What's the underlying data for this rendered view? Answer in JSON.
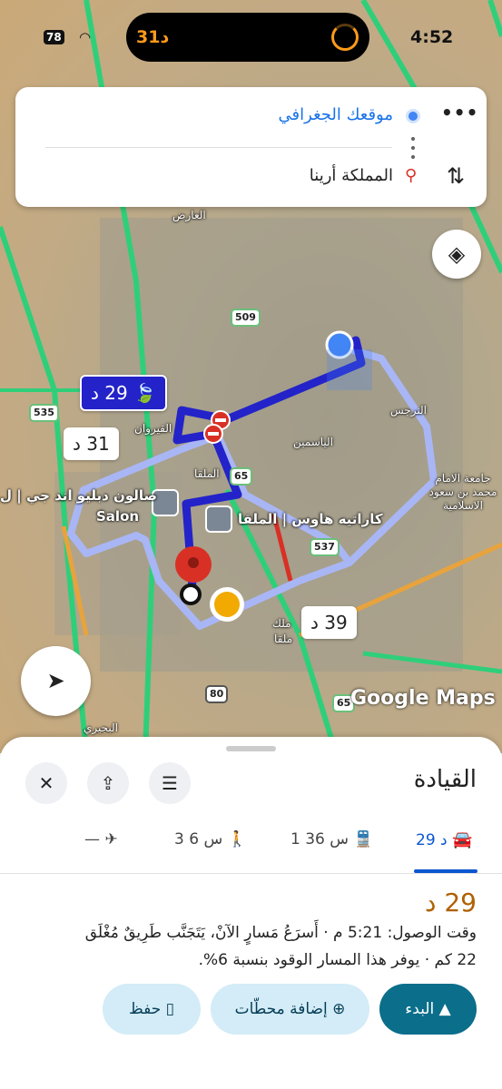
{
  "status_bar": {
    "time": "4:52",
    "battery": "78",
    "island_text": "31د"
  },
  "route_inputs": {
    "origin": "موقعك الجغرافي",
    "destination": "المملكة أرينا"
  },
  "map": {
    "labels": {
      "alaridh": "العارض",
      "alqirawan": "القيروان",
      "alyasmin": "الياسمين",
      "alnarjis": "النرجس",
      "almalqa": "الملقا",
      "salon_ar": "صالون دبليو اند جي | ل",
      "salon_en": "Salon",
      "karatih": "كاراتيه هاوس | الملقا",
      "university": "جامعة الامام محمد بن سعود الاسلامية",
      "albujairi": "البجيري",
      "malik": "ملك",
      "almalqa2": "ملقا"
    },
    "shields": [
      "509",
      "535",
      "65",
      "537",
      "80",
      "65"
    ],
    "bubbles": {
      "selected": "29 د",
      "alt1": "31 د",
      "alt2": "39 د"
    },
    "watermark": "Google Maps"
  },
  "sheet": {
    "title": "القيادة",
    "tabs": {
      "drive": "29 د",
      "transit": "1 س 36",
      "walk": "3 س 6",
      "flight": "—"
    },
    "duration": "29 د",
    "arrival_line": "وقت الوصول: 5:21 م · أَسرَعُ مَسارٍ الآنْ، يَتَجَنَّب طَرِيقٌ مُغْلَق",
    "distance_line": "22 كم · يوفر هذا المسار الوقود بنسبة 6%.",
    "buttons": {
      "start": "البدء",
      "add_stops": "إضافة محطّات",
      "save": "حفظ"
    }
  },
  "colors": {
    "selected_route": "#2323c9",
    "alt_route": "#a9b6f5",
    "primary": "#0b57d0",
    "start_button": "#0b6e8a",
    "duration": "#b06000"
  }
}
